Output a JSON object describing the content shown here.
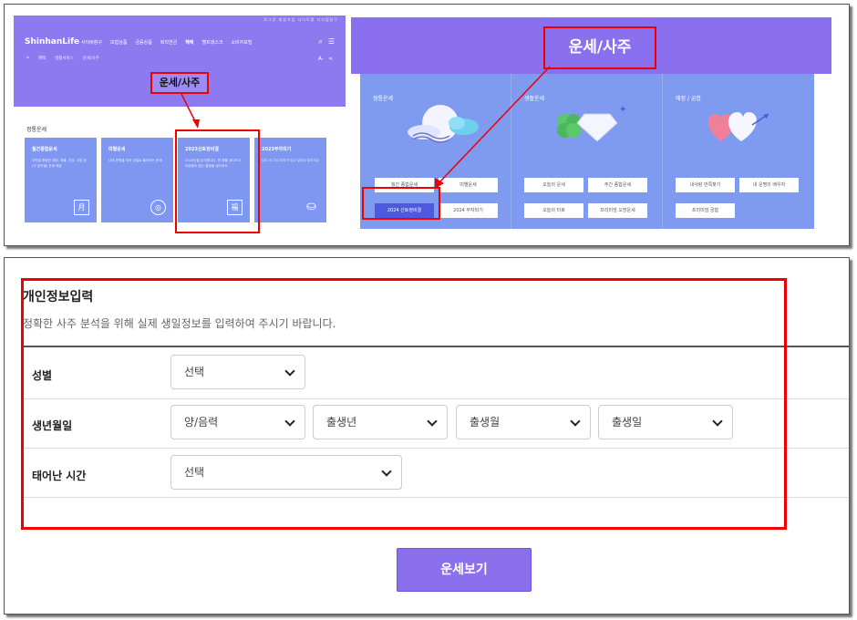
{
  "site": {
    "top_links": "로그인  회원가입  사이트맵  디지털창구",
    "logo": "ShinhanLife",
    "nav": [
      "사이버창구",
      "보험상품",
      "금융상품",
      "퇴직연금",
      "혜택",
      "헬프데스크",
      "소비자포털"
    ],
    "breadcrumb": [
      "⌂",
      "혜택",
      "생활서비스",
      "운세/사주"
    ],
    "font_controls": [
      "A-",
      "<"
    ],
    "overlay_label": "운세/사주",
    "section_title": "정통운세",
    "cards": [
      {
        "title": "월간종합운세",
        "desc": "이번달 종합운 애정, 재물, 건강, 사업 등 (각 분야별) 운세 제공",
        "icon": "月"
      },
      {
        "title": "띠별운세",
        "desc": "나의 운명을 띠의 성질로 풀어보는 운세",
        "icon": "◎"
      },
      {
        "title": "2023신토정비결",
        "desc": "2023년을 분석합니다. 한 해를 내다보고 아쉬움이 없는 결정을 내리세요.",
        "icon": "福"
      },
      {
        "title": "2023부자되기",
        "desc": "나도 이 그리 부자가 되고 싶어서 부자지수 ",
        "icon": "⛀"
      }
    ]
  },
  "menu": {
    "title": "운세/사주",
    "columns": [
      {
        "title": "정통운세",
        "buttons": [
          "월간 종합운세",
          "띠별운세",
          "2024 신토정비결",
          "2024 부자되기"
        ],
        "active": "2024 신토정비결"
      },
      {
        "title": "생활운세",
        "buttons": [
          "오늘의 운세",
          "주간 종합운세",
          "오늘의 타로",
          "프리미엄 오방운세"
        ]
      },
      {
        "title": "애정 / 궁합",
        "buttons": [
          "내사랑 반쪽찾기",
          "내 운명의 배우자",
          "프리미엄 궁합"
        ]
      }
    ]
  },
  "form": {
    "title": "개인정보입력",
    "desc": "정확한 사주 분석을 위해 실제 생일정보를 입력하여 주시기 바랍니다.",
    "rows": [
      {
        "label": "성별",
        "selects": [
          "선택"
        ]
      },
      {
        "label": "생년월일",
        "selects": [
          "양/음력",
          "출생년",
          "출생월",
          "출생일"
        ]
      },
      {
        "label": "태어난 시간",
        "selects": [
          "선택"
        ]
      }
    ],
    "submit": "운세보기"
  },
  "colors": {
    "purple": "#8a70ef",
    "card_blue": "#7f97f0",
    "highlight_red": "#e00000"
  }
}
